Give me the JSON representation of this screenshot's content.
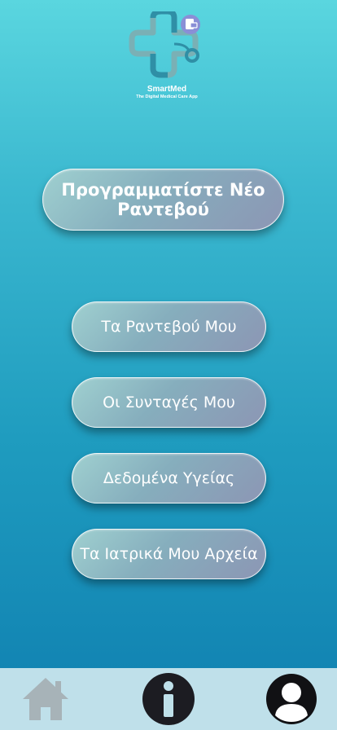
{
  "app": {
    "brand": "SmartMed",
    "tagline": "The Digital Medical Care App"
  },
  "main": {
    "new_appointment_label": "Προγραμματίστε Νέο Ραντεβού",
    "menu": [
      "Τα Ραντεβού Μου",
      "Οι Συνταγές Μου",
      "Δεδομένα Υγείας",
      "Τα Ιατρικά Μου Αρχεία"
    ]
  },
  "navbar": {
    "items": [
      "home-icon",
      "info-icon",
      "user-profile-icon"
    ]
  },
  "colors": {
    "background_top": "#5ad6df",
    "background_bottom": "#0f7fb0",
    "navbar": "#bfe0ea",
    "logo_primary": "#2f8fa6",
    "logo_badge": "#8a8fd6"
  }
}
